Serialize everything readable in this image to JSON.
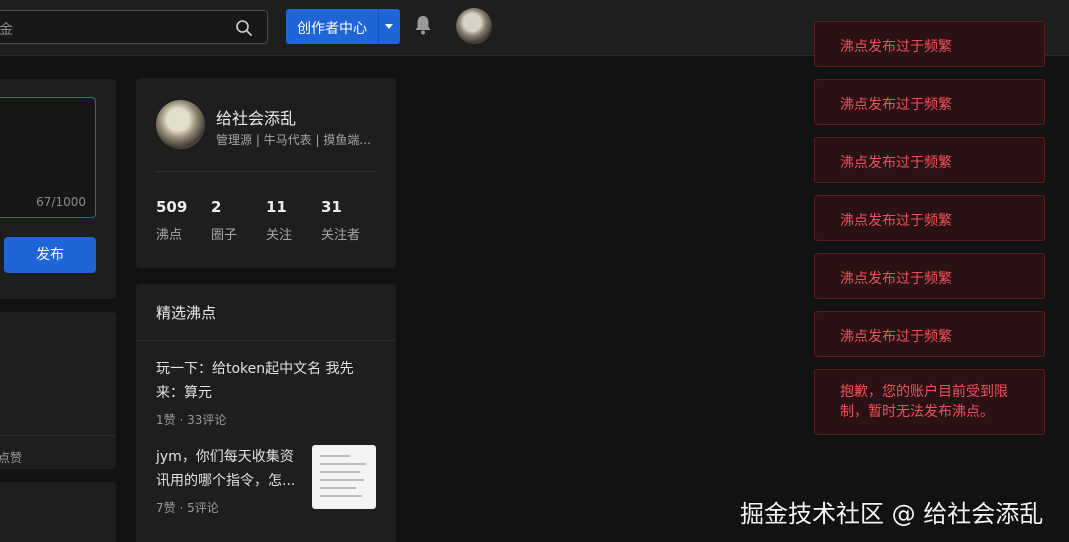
{
  "header": {
    "search_text": "金",
    "creator_label": "创作者中心"
  },
  "composer": {
    "char_count": "67/1000",
    "publish_label": "发布"
  },
  "left_feed": {
    "like_label": "点赞"
  },
  "profile": {
    "name": "给社会添乱",
    "tags": "管理源 | 牛马代表 | 摸鱼端...",
    "stats": [
      {
        "value": "509",
        "label": "沸点"
      },
      {
        "value": "2",
        "label": "圈子"
      },
      {
        "value": "11",
        "label": "关注"
      },
      {
        "value": "31",
        "label": "关注者"
      }
    ]
  },
  "featured": {
    "title": "精选沸点",
    "posts": [
      {
        "text_line1": "玩一下：给token起中文名 我先",
        "text_line2": "来：算元",
        "meta": "1赞 · 33评论"
      },
      {
        "text_line1": "jym，你们每天收集资",
        "text_line2": "讯用的哪个指令，怎...",
        "meta": "7赞 · 5评论"
      }
    ]
  },
  "toasts": [
    "沸点发布过于频繁",
    "沸点发布过于频繁",
    "沸点发布过于频繁",
    "沸点发布过于频繁",
    "沸点发布过于频繁",
    "沸点发布过于频繁",
    "抱歉，您的账户目前受到限制，暂时无法发布沸点。"
  ],
  "watermark": "掘金技术社区 @ 给社会添乱",
  "colors": {
    "accent": "#1e66d8",
    "toast_text": "#f0505a",
    "toast_bg": "#2a1214"
  }
}
